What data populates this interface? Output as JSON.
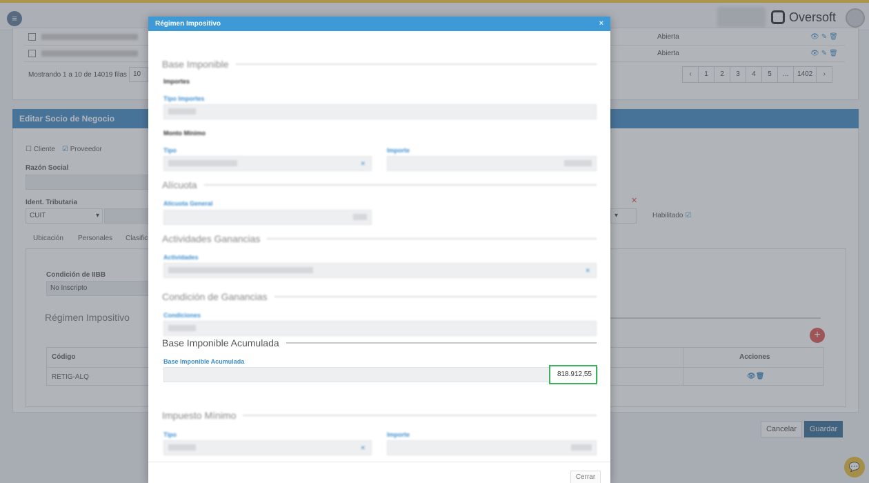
{
  "app": {
    "brand": "Oversoft",
    "menu_icon": "menu-icon"
  },
  "background": {
    "rows": [
      {
        "status": "Abierta"
      },
      {
        "status": "Abierta"
      }
    ],
    "pagination": {
      "info": "Mostrando 1 a 10 de 14019 filas",
      "page_size": "10",
      "pages": [
        "‹",
        "1",
        "2",
        "3",
        "4",
        "5",
        "...",
        "1402",
        "›"
      ]
    },
    "edit_panel": {
      "title": "Editar Socio de Negocio",
      "cliente_label": "Cliente",
      "proveedor_label": "Proveedor",
      "razon_social_label": "Razón Social",
      "ident_label": "Ident. Tributaria",
      "ident_type": "CUIT",
      "habilitado_label": "Habilitado",
      "tabs": [
        "Ubicación",
        "Personales",
        "Clasific"
      ],
      "condicion_iibb_label": "Condición de IIBB",
      "condicion_iibb_value": "No Inscripto",
      "regimen_title": "Régimen Impositivo",
      "table_headers": {
        "codigo": "Código",
        "acciones": "Acciones"
      },
      "table_row": {
        "codigo": "RETIG-ALQ"
      },
      "cancel_label": "Cancelar",
      "save_label": "Guardar"
    }
  },
  "modal": {
    "title": "Régimen Impositivo",
    "close_glyph": "×",
    "sections": {
      "base_imponible": "Base Imponible",
      "importes": "Importes",
      "tipo_importes": "Tipo Importes",
      "monto_minimo": "Monto Mínimo",
      "tipo": "Tipo",
      "importe": "Importe",
      "alicuota": "Alícuota",
      "alicuota_general": "Alícuota General",
      "actividades_ganancias": "Actividades Ganancias",
      "actividades": "Actividades",
      "condicion_ganancias": "Condición de Ganancias",
      "condiciones": "Condiciones",
      "impuesto_minimo": "Impuesto Mínimo",
      "impuesto_tipo": "Tipo",
      "impuesto_importe": "Importe"
    },
    "base_acumulada": {
      "title": "Base Imponible Acumulada",
      "label": "Base Imponible Acumulada",
      "value": "818.912,55"
    },
    "close_button": "Cerrar"
  }
}
